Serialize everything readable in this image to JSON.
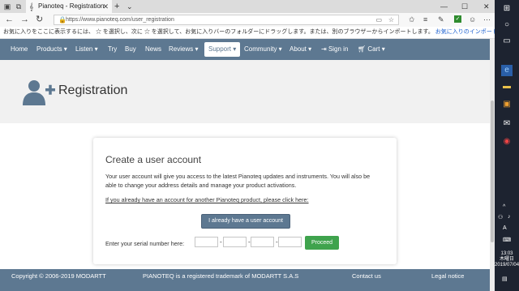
{
  "browser": {
    "tab_title": "Pianoteq - Registration",
    "tab_close": "✕",
    "new_tab": "+",
    "url": "https://www.pianoteq.com/user_registration",
    "favorites_bar_text": "お気に入りをここに表示するには、 ☆ を選択し、次に ☆ を選択して、お気に入りバーのフォルダーにドラッグします。または、別のブラウザーからインポートします。",
    "favorites_bar_link": "お気に入りのインポート"
  },
  "nav": {
    "items": [
      {
        "label": "Home"
      },
      {
        "label": "Products ▾"
      },
      {
        "label": "Listen ▾"
      },
      {
        "label": "Try"
      },
      {
        "label": "Buy"
      },
      {
        "label": "News"
      },
      {
        "label": "Reviews ▾"
      },
      {
        "label": "Support ▾"
      },
      {
        "label": "Community ▾"
      },
      {
        "label": "About ▾"
      },
      {
        "label": "Sign in"
      },
      {
        "label": "Cart ▾"
      }
    ]
  },
  "page": {
    "title": "Registration",
    "card": {
      "title": "Create a user account",
      "description": "Your user account will give you access to the latest Pianoteq updates and instruments. You will also be able to change your address details and manage your product activations.",
      "link_text": "If you already have an account for another Pianoteq product, please click here:",
      "have_account_button": "I already have a user account",
      "serial_label": "Enter your serial number here:",
      "serial_separator": "-",
      "proceed_button": "Proceed"
    }
  },
  "footer": {
    "copyright": "Copyright © 2006-2019 MODARTT",
    "trademark": "PIANOTEQ is a registered trademark of MODARTT S.A.S",
    "contact": "Contact us",
    "legal": "Legal notice"
  },
  "taskbar": {
    "time": "13:03",
    "day": "木曜日",
    "date": "2019/07/04",
    "lang": "A"
  },
  "colors": {
    "nav_bg": "#5d7891",
    "proceed_green": "#3fa34d",
    "taskbar_bg": "#1d2330"
  }
}
